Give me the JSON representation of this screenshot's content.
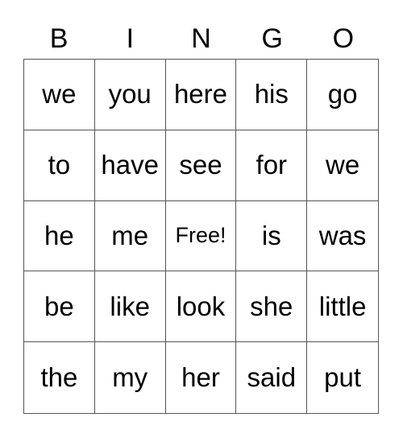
{
  "header": [
    "B",
    "I",
    "N",
    "G",
    "O"
  ],
  "rows": [
    [
      "we",
      "you",
      "here",
      "his",
      "go"
    ],
    [
      "to",
      "have",
      "see",
      "for",
      "we"
    ],
    [
      "he",
      "me",
      "Free!",
      "is",
      "was"
    ],
    [
      "be",
      "like",
      "look",
      "she",
      "little"
    ],
    [
      "the",
      "my",
      "her",
      "said",
      "put"
    ]
  ]
}
